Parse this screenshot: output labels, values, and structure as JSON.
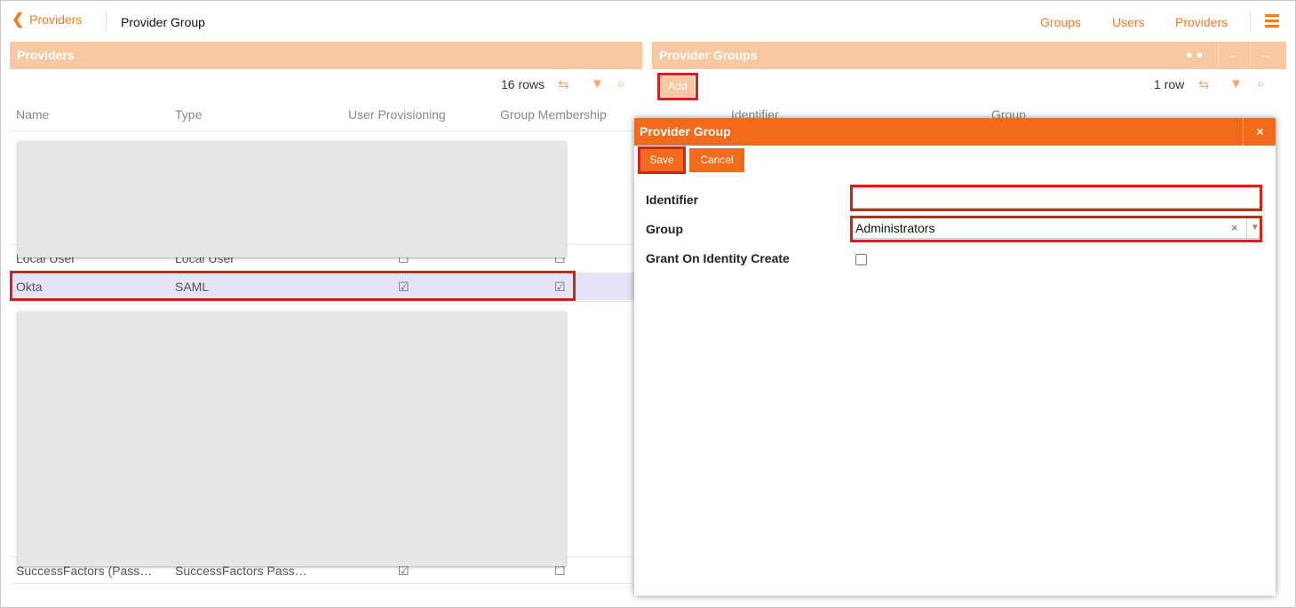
{
  "topbar": {
    "back_label": "Providers",
    "title": "Provider Group",
    "nav": [
      "Groups",
      "Users",
      "Providers"
    ]
  },
  "providers_panel": {
    "title": "Providers",
    "row_count": "16 rows",
    "columns": [
      "Name",
      "Type",
      "User Provisioning",
      "Group Membership"
    ],
    "rows": [
      {
        "name": "Local User",
        "type": "Local User",
        "user_prov": "☐",
        "group_mem": "☐"
      },
      {
        "name": "Okta",
        "type": "SAML",
        "user_prov": "☑",
        "group_mem": "☑"
      },
      {
        "name": "SuccessFactors (Pass…",
        "type": "SuccessFactors Pass…",
        "user_prov": "☑",
        "group_mem": "☐"
      }
    ]
  },
  "provider_groups_panel": {
    "title": "Provider Groups",
    "add_label": "Add",
    "row_count": "1 row",
    "columns": [
      "Identifier",
      "Group"
    ]
  },
  "modal": {
    "title": "Provider Group",
    "close_label": "×",
    "save_label": "Save",
    "cancel_label": "Cancel",
    "fields": {
      "identifier_label": "Identifier",
      "identifier_value": "",
      "group_label": "Group",
      "group_value": "Administrators",
      "grant_label": "Grant On Identity Create",
      "grant_checked": false
    }
  },
  "colors": {
    "accent": "#f47c20",
    "header_light": "#f9c7a0",
    "modal_header": "#f26b1d",
    "highlight": "#d0231c"
  }
}
